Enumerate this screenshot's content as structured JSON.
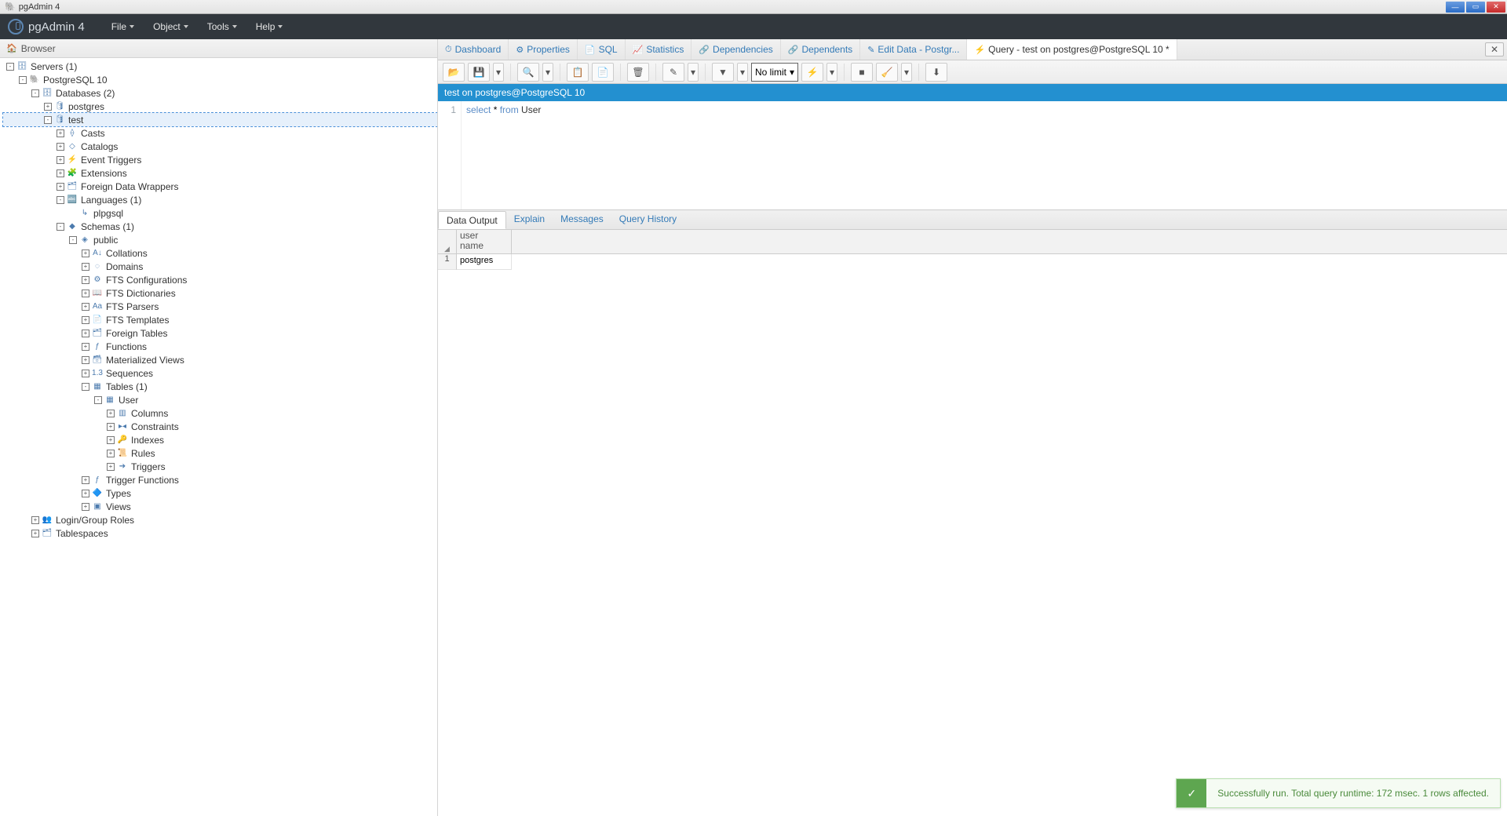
{
  "window_title": "pgAdmin 4",
  "menubar": {
    "logo": "pgAdmin 4",
    "items": [
      "File",
      "Object",
      "Tools",
      "Help"
    ]
  },
  "browser": {
    "title": "Browser",
    "tree": [
      {
        "indent": 0,
        "exp": "-",
        "icon": "🗄",
        "label": "Servers (1)"
      },
      {
        "indent": 1,
        "exp": "-",
        "icon": "🐘",
        "label": "PostgreSQL 10"
      },
      {
        "indent": 2,
        "exp": "-",
        "icon": "🗄",
        "label": "Databases (2)"
      },
      {
        "indent": 3,
        "exp": "+",
        "icon": "🛢",
        "label": "postgres"
      },
      {
        "indent": 3,
        "exp": "-",
        "icon": "🛢",
        "label": "test",
        "selected": true
      },
      {
        "indent": 4,
        "exp": "+",
        "icon": "⟠",
        "label": "Casts"
      },
      {
        "indent": 4,
        "exp": "+",
        "icon": "◇",
        "label": "Catalogs"
      },
      {
        "indent": 4,
        "exp": "+",
        "icon": "⚡",
        "label": "Event Triggers"
      },
      {
        "indent": 4,
        "exp": "+",
        "icon": "🧩",
        "label": "Extensions"
      },
      {
        "indent": 4,
        "exp": "+",
        "icon": "🗂",
        "label": "Foreign Data Wrappers"
      },
      {
        "indent": 4,
        "exp": "-",
        "icon": "🔤",
        "label": "Languages (1)"
      },
      {
        "indent": 5,
        "exp": "",
        "icon": "↳",
        "label": "plpgsql"
      },
      {
        "indent": 4,
        "exp": "-",
        "icon": "◆",
        "label": "Schemas (1)"
      },
      {
        "indent": 5,
        "exp": "-",
        "icon": "◈",
        "label": "public"
      },
      {
        "indent": 6,
        "exp": "+",
        "icon": "A↓",
        "label": "Collations"
      },
      {
        "indent": 6,
        "exp": "+",
        "icon": "◌",
        "label": "Domains"
      },
      {
        "indent": 6,
        "exp": "+",
        "icon": "⚙",
        "label": "FTS Configurations"
      },
      {
        "indent": 6,
        "exp": "+",
        "icon": "📖",
        "label": "FTS Dictionaries"
      },
      {
        "indent": 6,
        "exp": "+",
        "icon": "Aa",
        "label": "FTS Parsers"
      },
      {
        "indent": 6,
        "exp": "+",
        "icon": "📄",
        "label": "FTS Templates"
      },
      {
        "indent": 6,
        "exp": "+",
        "icon": "🗂",
        "label": "Foreign Tables"
      },
      {
        "indent": 6,
        "exp": "+",
        "icon": "ƒ",
        "label": "Functions"
      },
      {
        "indent": 6,
        "exp": "+",
        "icon": "🗃",
        "label": "Materialized Views"
      },
      {
        "indent": 6,
        "exp": "+",
        "icon": "1.3",
        "label": "Sequences"
      },
      {
        "indent": 6,
        "exp": "-",
        "icon": "▦",
        "label": "Tables (1)"
      },
      {
        "indent": 7,
        "exp": "-",
        "icon": "▦",
        "label": "User"
      },
      {
        "indent": 8,
        "exp": "+",
        "icon": "▥",
        "label": "Columns"
      },
      {
        "indent": 8,
        "exp": "+",
        "icon": "▸◂",
        "label": "Constraints"
      },
      {
        "indent": 8,
        "exp": "+",
        "icon": "🔑",
        "label": "Indexes"
      },
      {
        "indent": 8,
        "exp": "+",
        "icon": "📜",
        "label": "Rules"
      },
      {
        "indent": 8,
        "exp": "+",
        "icon": "➔",
        "label": "Triggers"
      },
      {
        "indent": 6,
        "exp": "+",
        "icon": "ƒ",
        "label": "Trigger Functions"
      },
      {
        "indent": 6,
        "exp": "+",
        "icon": "🔷",
        "label": "Types"
      },
      {
        "indent": 6,
        "exp": "+",
        "icon": "▣",
        "label": "Views"
      },
      {
        "indent": 2,
        "exp": "+",
        "icon": "👥",
        "label": "Login/Group Roles"
      },
      {
        "indent": 2,
        "exp": "+",
        "icon": "🗂",
        "label": "Tablespaces"
      }
    ]
  },
  "tabs": [
    {
      "icon": "⏱",
      "label": "Dashboard"
    },
    {
      "icon": "⚙",
      "label": "Properties"
    },
    {
      "icon": "📄",
      "label": "SQL"
    },
    {
      "icon": "📈",
      "label": "Statistics"
    },
    {
      "icon": "🔗",
      "label": "Dependencies"
    },
    {
      "icon": "🔗",
      "label": "Dependents"
    },
    {
      "icon": "✎",
      "label": "Edit Data - Postgr..."
    },
    {
      "icon": "⚡",
      "label": "Query - test on postgres@PostgreSQL 10 *",
      "active": true,
      "dark": true
    }
  ],
  "toolbar": {
    "limit": "No limit"
  },
  "editor": {
    "title": "test on postgres@PostgreSQL 10",
    "line_no": "1",
    "kw_select": "select",
    "star": " * ",
    "kw_from": "from",
    "ident": " User"
  },
  "result_tabs": [
    "Data Output",
    "Explain",
    "Messages",
    "Query History"
  ],
  "grid": {
    "col_header_l1": "user",
    "col_header_l2": "name",
    "corner": "◢",
    "rows": [
      {
        "n": "1",
        "val": "postgres"
      }
    ]
  },
  "toast": {
    "icon": "✓",
    "msg": "Successfully run. Total query runtime: 172 msec. 1 rows affected."
  }
}
